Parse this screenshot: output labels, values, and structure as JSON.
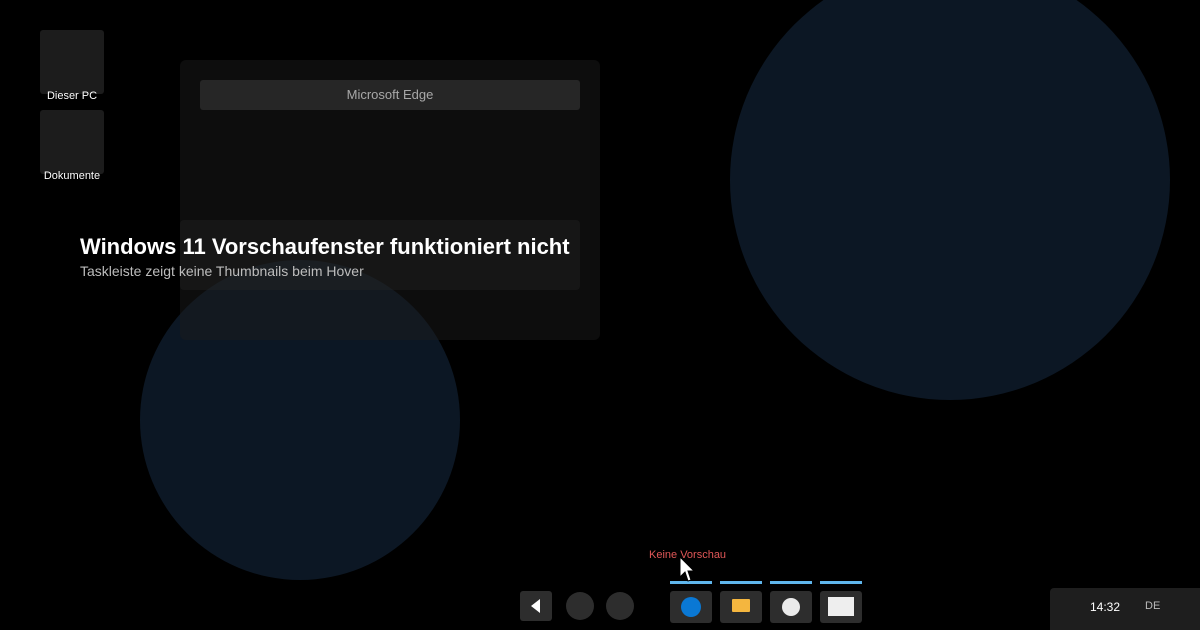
{
  "desktop": {
    "icons": [
      {
        "label": "Dieser PC"
      },
      {
        "label": "Dokumente"
      }
    ]
  },
  "window": {
    "title": "Microsoft Edge"
  },
  "headline": {
    "title": "Windows 11 Vorschaufenster funktioniert nicht",
    "subtitle": "Taskleiste zeigt keine Thumbnails beim Hover"
  },
  "tooltip": {
    "text": "Keine Vorschau",
    "color": "#e05757"
  },
  "taskbar": {
    "buttons": [
      {
        "icon": "start-arrow-icon"
      },
      {
        "icon": "search-icon"
      },
      {
        "icon": "task-view-icon"
      }
    ],
    "apps": [
      {
        "icon": "edge-icon",
        "color": "#0a78d4",
        "running": true
      },
      {
        "icon": "folder-icon",
        "color": "#f4b63f",
        "running": true
      },
      {
        "icon": "settings-icon",
        "color": "#eaeaea",
        "running": true
      },
      {
        "icon": "notepad-icon",
        "color": "#eeeeee",
        "running": true
      }
    ],
    "indicator_color": "#5fb6ec"
  },
  "tray": {
    "time": "14:32",
    "language": "DE"
  }
}
